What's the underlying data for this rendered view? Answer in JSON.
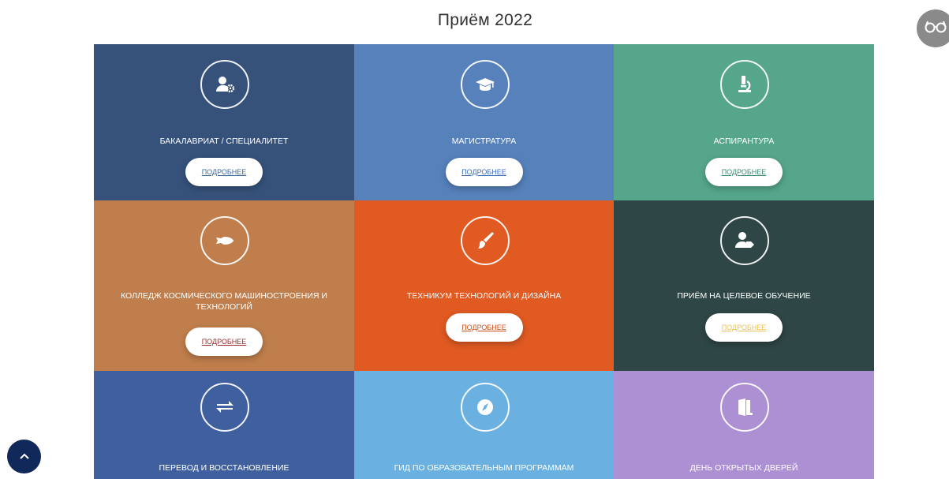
{
  "page": {
    "title": "Приём 2022"
  },
  "more_label": "ПОДРОБНЕЕ",
  "tiles": [
    {
      "label": "БАКАЛАВРИАТ / СПЕЦИАЛИТЕТ",
      "icon": "user-gear-icon",
      "color": "#36527a",
      "link_color": "#3e6a9a"
    },
    {
      "label": "МАГИСТРАТУРА",
      "icon": "graduation-cap-icon",
      "color": "#5681bb",
      "link_color": "#3d6cb5"
    },
    {
      "label": "АСПИРАНТУРА",
      "icon": "microscope-icon",
      "color": "#55a68a",
      "link_color": "#3c8a70"
    },
    {
      "label": "КОЛЛЕДЖ КОСМИЧЕСКОГО МАШИНОСТРОЕНИЯ И ТЕХНОЛОГИЙ",
      "icon": "space-shuttle-icon",
      "color": "#bf7e4c",
      "link_color": "#9c2b2b"
    },
    {
      "label": "ТЕХНИКУМ ТЕХНОЛОГИЙ И ДИЗАЙНА",
      "icon": "paint-brush-icon",
      "color": "#e05a22",
      "link_color": "#c9501d"
    },
    {
      "label": "ПРИЁМ НА ЦЕЛЕВОЕ ОБУЧЕНИЕ",
      "icon": "user-tag-icon",
      "color": "#2e4645",
      "link_color": "#e8c25a"
    },
    {
      "label": "ПЕРЕВОД И ВОССТАНОВЛЕНИЕ",
      "icon": "exchange-arrows-icon",
      "color": "#3f5f9f"
    },
    {
      "label": "ГИД ПО ОБРАЗОВАТЕЛЬНЫМ ПРОГРАММАМ",
      "icon": "compass-icon",
      "color": "#6ab0e0"
    },
    {
      "label": "ДЕНЬ ОТКРЫТЫХ ДВЕРЕЙ",
      "icon": "door-open-icon",
      "color": "#ad8fd3"
    }
  ],
  "accessibility": {
    "icon": "glasses-icon"
  },
  "scroll_top": {
    "icon": "chevron-up-icon"
  }
}
